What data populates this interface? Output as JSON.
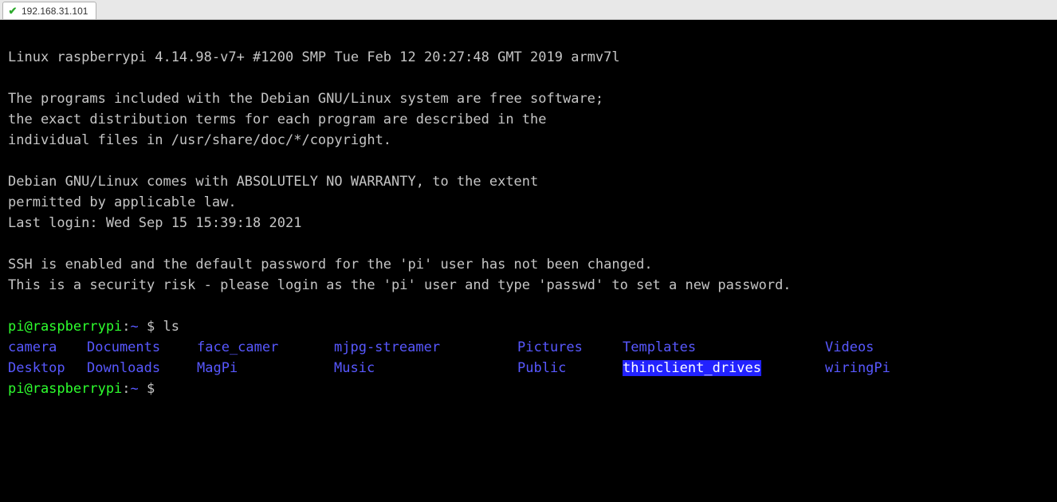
{
  "tab": {
    "title": "192.168.31.101"
  },
  "motd": {
    "line1": "Linux raspberrypi 4.14.98-v7+ #1200 SMP Tue Feb 12 20:27:48 GMT 2019 armv7l",
    "blank1": "",
    "line2": "The programs included with the Debian GNU/Linux system are free software;",
    "line3": "the exact distribution terms for each program are described in the",
    "line4": "individual files in /usr/share/doc/*/copyright.",
    "blank2": "",
    "line5": "Debian GNU/Linux comes with ABSOLUTELY NO WARRANTY, to the extent",
    "line6": "permitted by applicable law.",
    "line7": "Last login: Wed Sep 15 15:39:18 2021",
    "blank3": "",
    "line8": "SSH is enabled and the default password for the 'pi' user has not been changed.",
    "line9": "This is a security risk - please login as the 'pi' user and type 'passwd' to set a new password.",
    "blank4": ""
  },
  "prompt": {
    "user_host": "pi@raspberrypi",
    "sep": ":",
    "path": "~ ",
    "dollar": "$ "
  },
  "cmd1": "ls",
  "ls": {
    "c1r1": "camera",
    "c1r2": "Desktop",
    "c2r1": "Documents",
    "c2r2": "Downloads",
    "c3r1": "face_camer",
    "c3r2": "MagPi",
    "c4r1": "mjpg-streamer",
    "c4r2": "Music",
    "c5r1": "Pictures",
    "c5r2": "Public",
    "c6r1": "Templates",
    "c6r2": "thinclient_drives",
    "c7r1": "Videos",
    "c7r2": "wiringPi"
  }
}
